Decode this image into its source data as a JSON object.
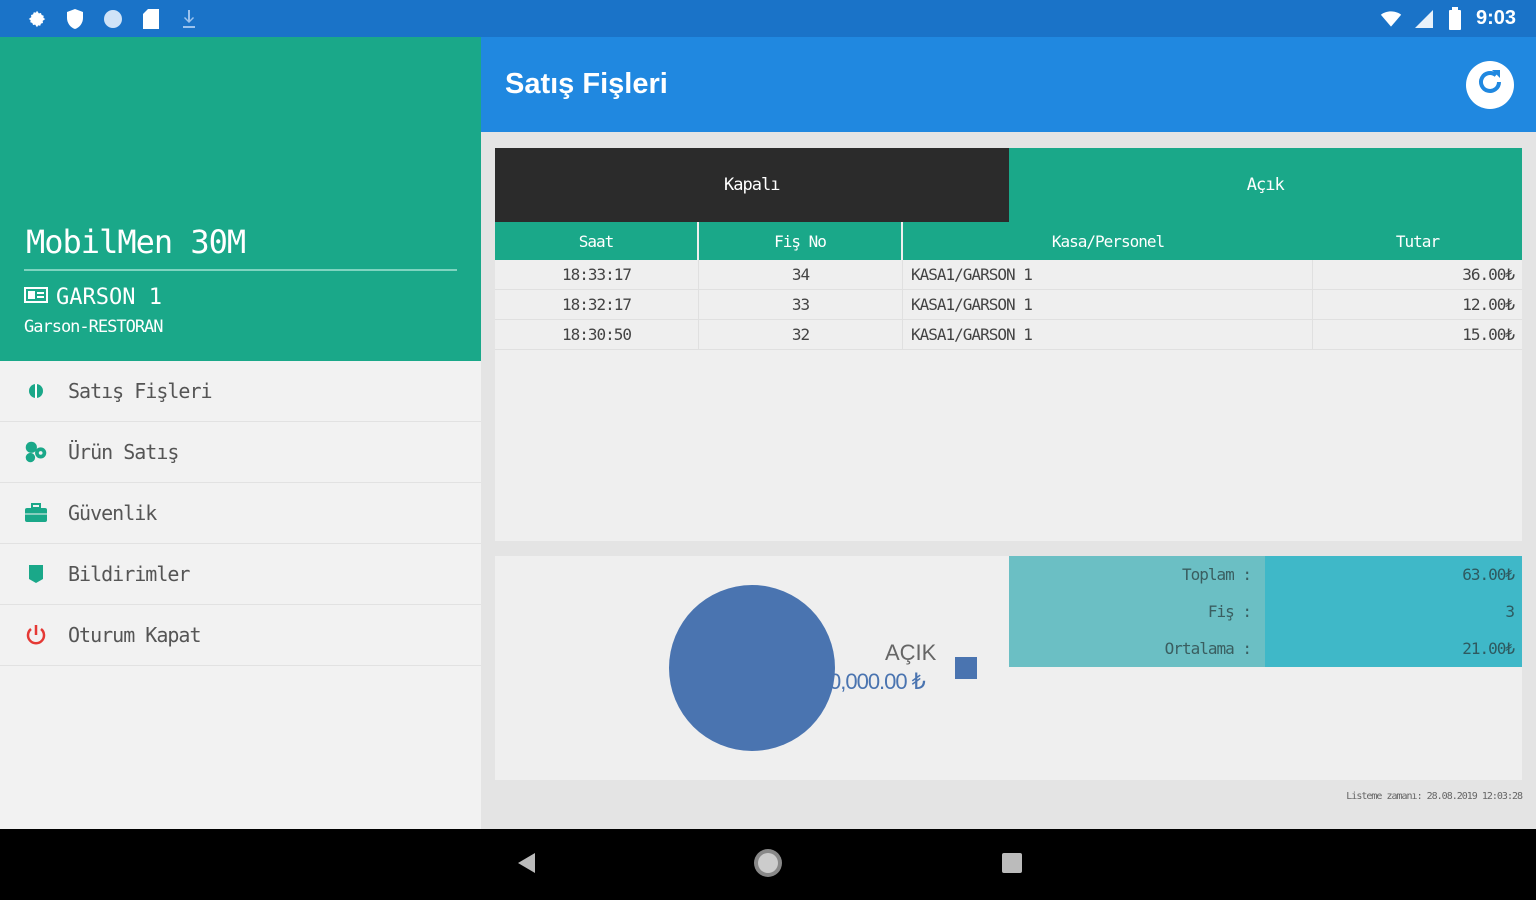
{
  "status_bar": {
    "time": "9:03",
    "icons": [
      "gear-icon",
      "shield-icon",
      "circle-icon",
      "sd-card-icon",
      "download-icon",
      "wifi-icon",
      "signal-icon",
      "battery-icon"
    ]
  },
  "drawer": {
    "app_name": "MobilMen 30M",
    "user_name": "GARSON 1",
    "user_role": "Garson-RESTORAN",
    "items": [
      {
        "label": "Satış Fişleri",
        "icon": "receipt-icon"
      },
      {
        "label": "Ürün Satış",
        "icon": "products-icon"
      },
      {
        "label": "Güvenlik",
        "icon": "briefcase-icon"
      },
      {
        "label": "Bildirimler",
        "icon": "notification-icon"
      },
      {
        "label": "Oturum Kapat",
        "icon": "power-icon"
      }
    ]
  },
  "appbar": {
    "title": "Satış Fişleri"
  },
  "tabs": [
    {
      "label": "Kapalı"
    },
    {
      "label": "Açık"
    }
  ],
  "table": {
    "headers": [
      "Saat",
      "Fiş No",
      "Kasa/Personel",
      "Tutar"
    ],
    "rows": [
      [
        "18:33:17",
        "34",
        "KASA1/GARSON 1",
        "36.00₺"
      ],
      [
        "18:32:17",
        "33",
        "KASA1/GARSON 1",
        "12.00₺"
      ],
      [
        "18:30:50",
        "32",
        "KASA1/GARSON 1",
        "15.00₺"
      ]
    ]
  },
  "legend": {
    "label": "AÇIK",
    "value": "0,000.00 ₺"
  },
  "stats": {
    "rows": [
      {
        "label": "Toplam :",
        "value": "63.00₺"
      },
      {
        "label": "Fiş :",
        "value": "3"
      },
      {
        "label": "Ortalama :",
        "value": "21.00₺"
      }
    ]
  },
  "footnote": "Listeme zamanı: 28.08.2019 12:03:28",
  "colors": {
    "status_bar": "#1a73c8",
    "drawer_header": "#1aa889",
    "appbar": "#2088e0",
    "tab_closed": "#2b2b2b",
    "tab_open": "#1aa889",
    "pie": "#4a74b0",
    "stat_label_bg": "#6bbfc4",
    "stat_value_bg": "#3fb8c8",
    "logout_red": "#e53935"
  }
}
